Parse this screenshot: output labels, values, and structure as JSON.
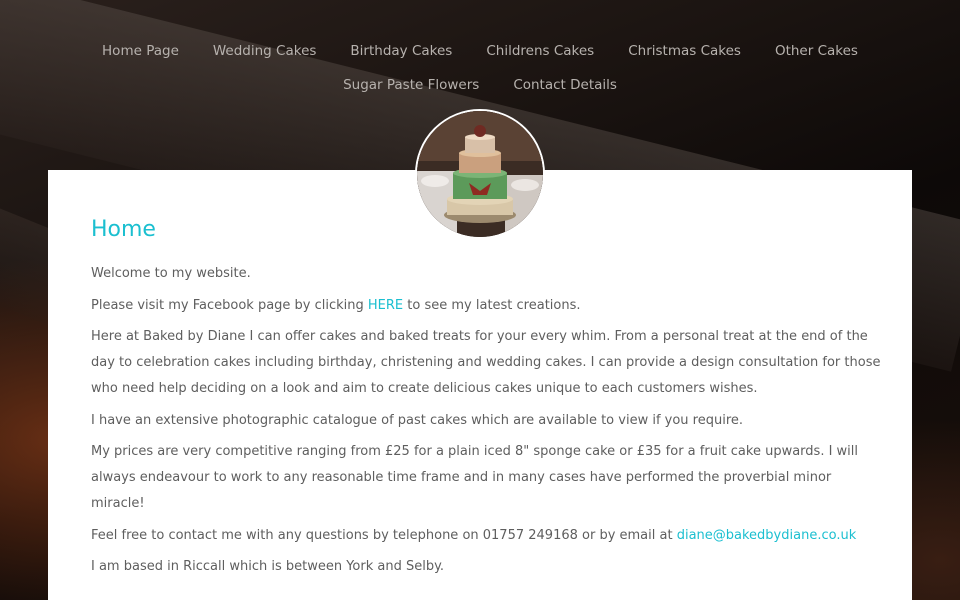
{
  "nav": {
    "items": [
      {
        "label": "Home Page"
      },
      {
        "label": "Wedding Cakes"
      },
      {
        "label": "Birthday Cakes"
      },
      {
        "label": "Childrens Cakes"
      },
      {
        "label": "Christmas Cakes"
      },
      {
        "label": "Other Cakes"
      },
      {
        "label": "Sugar Paste Flowers"
      },
      {
        "label": "Contact Details"
      }
    ]
  },
  "page": {
    "title": "Home",
    "p1": "Welcome to my website.",
    "p2_before": "Please visit my Facebook page by clicking ",
    "p2_link": "HERE",
    "p2_after": " to see my latest creations.",
    "p3": "Here at Baked by Diane I can offer cakes and baked treats for your every whim. From a personal treat at the end of the day to celebration cakes including birthday, christening and wedding cakes. I can provide a design consultation for those who need help deciding on a look and aim to create delicious cakes unique to each customers wishes.",
    "p4": "I have an extensive photographic catalogue of past cakes which are available to view if you require.",
    "p5": "My prices are very competitive ranging from £25 for a plain iced 8\" sponge cake or £35 for a fruit cake upwards. I will always endeavour to work to any reasonable time frame and in many cases have performed the proverbial minor miracle!",
    "p6_before": "Feel free to contact me with any questions by telephone on 01757 249168 or by email at ",
    "p6_link": "diane@bakedbydiane.co.uk",
    "p7": "I am based in Riccall which is between York and Selby."
  },
  "colors": {
    "accent": "#1bbfd0",
    "text": "#5e5e5e",
    "nav_text": "#b7b2ae",
    "panel": "#ffffff"
  }
}
